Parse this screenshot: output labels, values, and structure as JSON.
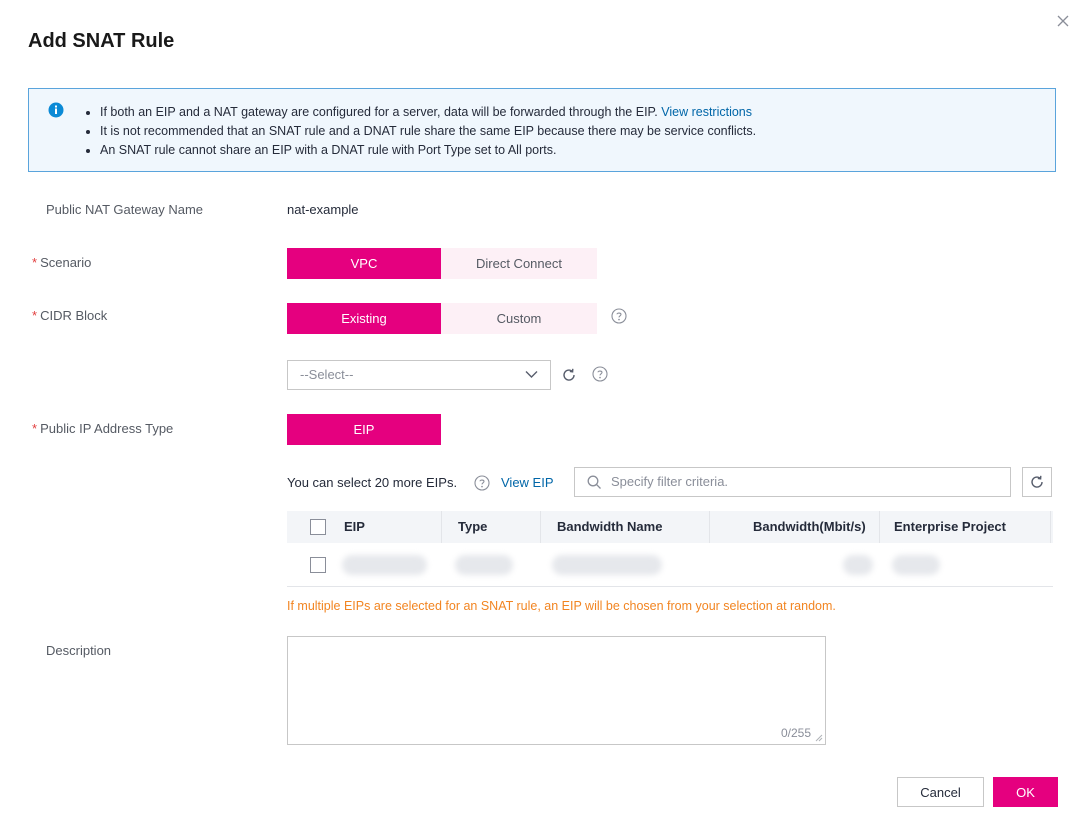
{
  "dialog": {
    "title": "Add SNAT Rule",
    "close_icon": "close-icon"
  },
  "notice": {
    "icon": "info-icon",
    "items": [
      "If both an EIP and a NAT gateway are configured for a server, data will be forwarded through the EIP.",
      "It is not recommended that an SNAT rule and a DNAT rule share the same EIP because there may be service conflicts.",
      "An SNAT rule cannot share an EIP with a DNAT rule with Port Type set to All ports."
    ],
    "link": "View restrictions"
  },
  "form": {
    "gateway": {
      "label": "Public NAT Gateway Name",
      "value": "nat-example"
    },
    "scenario": {
      "required": "*",
      "label": "Scenario",
      "options": [
        "VPC",
        "Direct Connect"
      ],
      "selected": "VPC"
    },
    "cidr": {
      "required": "*",
      "label": "CIDR Block",
      "options": [
        "Existing",
        "Custom"
      ],
      "selected": "Existing",
      "select_placeholder": "--Select--"
    },
    "public_ip": {
      "required": "*",
      "label": "Public IP Address Type",
      "option": "EIP",
      "remaining_text": "You can select 20 more EIPs.",
      "view_link": "View EIP",
      "search_placeholder": "Specify filter criteria."
    },
    "table": {
      "columns": [
        "EIP",
        "Type",
        "Bandwidth Name",
        "Bandwidth(Mbit/s)",
        "Enterprise Project"
      ]
    },
    "warning": "If multiple EIPs are selected for an SNAT rule, an EIP will be chosen from your selection at random.",
    "description": {
      "label": "Description",
      "counter": "0/255"
    }
  },
  "footer": {
    "cancel": "Cancel",
    "ok": "OK"
  },
  "colors": {
    "accent": "#e5007f",
    "accent_light": "#fdf0f6",
    "link": "#0066a8",
    "warning": "#f28522",
    "info_border": "#5aa4dc"
  }
}
